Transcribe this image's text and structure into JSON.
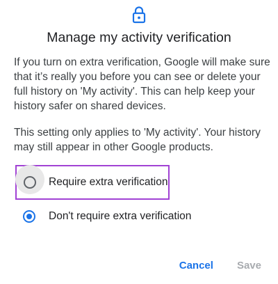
{
  "dialog": {
    "icon": "lock-icon",
    "title": "Manage my activity verification",
    "description_1": "If you turn on extra verification, Google will make sure that it’s really you before you can see or delete your full history on 'My activity'. This can help keep your history safer on shared devices.",
    "description_2": "This setting only applies to 'My activity'. Your history may still appear in other Google products.",
    "options": [
      {
        "label": "Require extra verification",
        "selected": false
      },
      {
        "label": "Don't require extra verification",
        "selected": true
      }
    ],
    "buttons": {
      "cancel": "Cancel",
      "save": "Save"
    },
    "colors": {
      "accent": "#1a73e8",
      "highlight_border": "#a142d4",
      "disabled_text": "#a8abaf"
    }
  }
}
